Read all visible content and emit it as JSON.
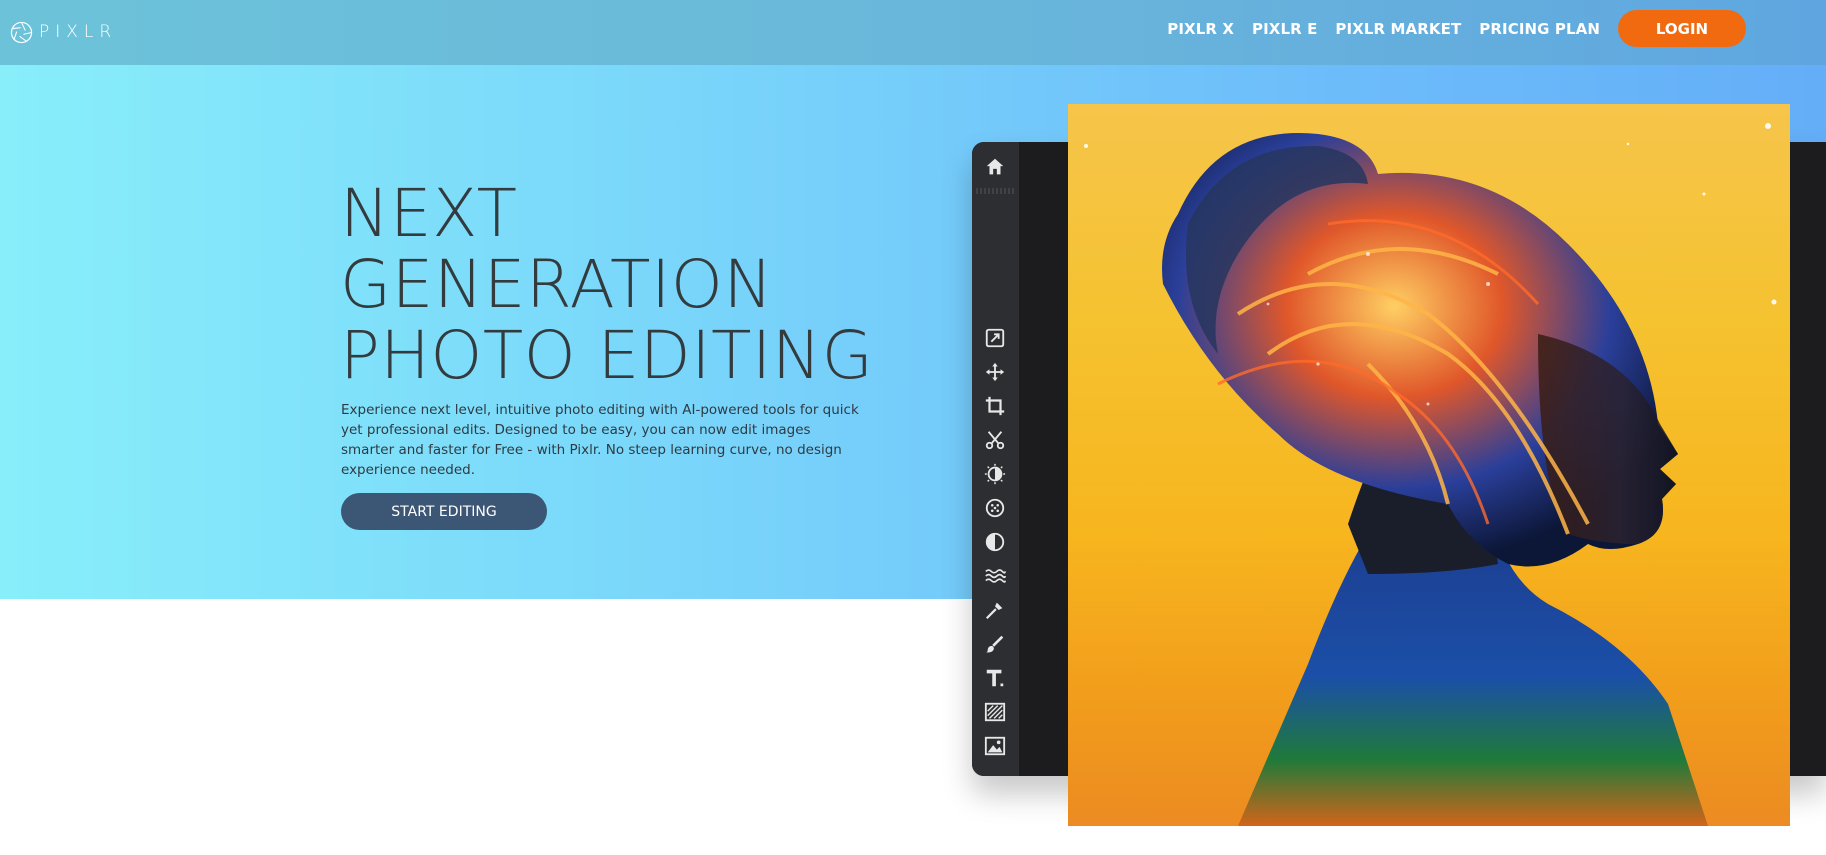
{
  "header": {
    "logo_text": "PIXLR",
    "nav": [
      "PIXLR X",
      "PIXLR E",
      "PIXLR MARKET",
      "PRICING PLAN"
    ],
    "login_label": "LOGIN"
  },
  "hero": {
    "headline": [
      "NEXT",
      "GENERATION",
      "PHOTO EDITING"
    ],
    "description": "Experience next level, intuitive photo editing with AI-powered tools for quick yet professional edits. Designed to be easy, you can now edit images smarter and faster for Free - with Pixlr. No steep learning curve, no design experience needed.",
    "cta_label": "START EDITING"
  },
  "editor": {
    "tools": [
      "home-icon",
      "edit-arrange-icon",
      "move-icon",
      "crop-icon",
      "cutout-icon",
      "adjust-icon",
      "filter-icon",
      "dodge-burn-icon",
      "liquify-icon",
      "heal-icon",
      "brush-icon",
      "text-icon",
      "pattern-icon",
      "image-add-icon"
    ]
  },
  "colors": {
    "accent": "#f26a0f",
    "cta": "#3c5676",
    "hero_gradient_start": "#88eefa",
    "hero_gradient_end": "#64aef7",
    "toolbar": "#2c2e31"
  }
}
